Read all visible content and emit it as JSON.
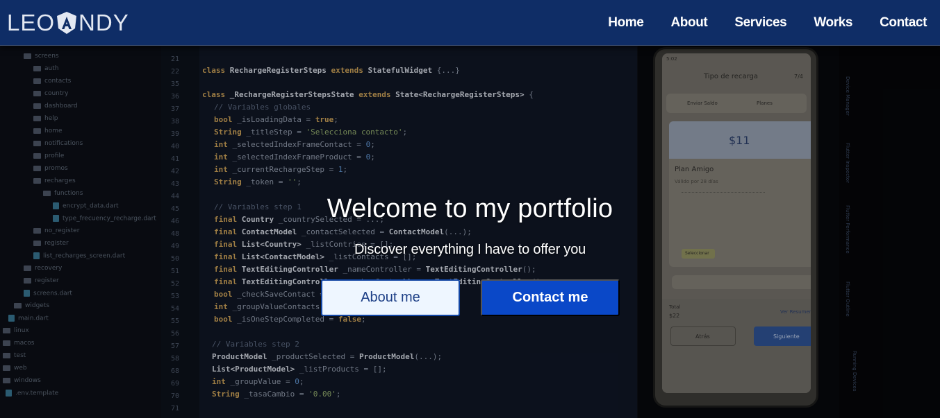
{
  "brand": {
    "logo_left": "LEO",
    "logo_right": "NDY",
    "logo_a_letter": "A"
  },
  "nav": {
    "items": [
      {
        "label": "Home"
      },
      {
        "label": "About"
      },
      {
        "label": "Services"
      },
      {
        "label": "Works"
      },
      {
        "label": "Contact"
      }
    ]
  },
  "hero": {
    "title": "Welcome to my portfolio",
    "subtitle": "Discover everything I have to offer you",
    "about_button": "About me",
    "contact_button": "Contact me"
  },
  "background_editor": {
    "tree": [
      "screens",
      "auth",
      "contacts",
      "country",
      "dashboard",
      "help",
      "home",
      "notifications",
      "profile",
      "promos",
      "recharges",
      "functions",
      "encrypt_data.dart",
      "type_frecuency_recharge.dart",
      "no_register",
      "register",
      "list_recharges_screen.dart",
      "recovery",
      "register",
      "screens.dart",
      "widgets",
      "main.dart",
      "linux",
      "macos",
      "test",
      "web",
      "windows",
      ".env.template"
    ],
    "line_numbers": [
      "21",
      "22",
      "35",
      "36",
      "37",
      "38",
      "39",
      "40",
      "41",
      "42",
      "43",
      "44",
      "45",
      "46",
      "48",
      "49",
      "50",
      "51",
      "52",
      "53",
      "54",
      "55",
      "56",
      "57",
      "58",
      "68",
      "69",
      "70",
      "71"
    ],
    "phone": {
      "title": "Tipo de recarga",
      "step": "7/4",
      "tab1": "Enviar Saldo",
      "tab2": "Planes",
      "price": "$11",
      "plan": "Plan Amigo",
      "validity": "Válido por 28 días",
      "select": "Seleccionar",
      "total_label": "Total",
      "total": "$22",
      "summary": "Ver Resumen",
      "back": "Atrás",
      "next": "Siguiente",
      "time": "5:02"
    }
  },
  "colors": {
    "navbar": "#0f2d66",
    "button_primary": "#0a48c8",
    "button_secondary_bg": "#eef6ff",
    "button_secondary_text": "#1d3f86"
  }
}
